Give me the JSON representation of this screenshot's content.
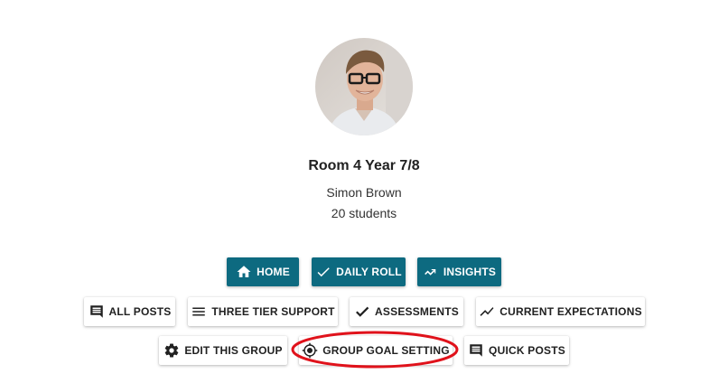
{
  "group": {
    "name": "Room 4 Year 7/8",
    "teacher": "Simon Brown",
    "student_count": "20 students"
  },
  "nav": {
    "home": "HOME",
    "daily_roll": "DAILY ROLL",
    "insights": "INSIGHTS"
  },
  "actions": {
    "all_posts": "ALL POSTS",
    "three_tier_support": "THREE TIER SUPPORT",
    "assessments": "ASSESSMENTS",
    "current_expectations": "CURRENT EXPECTATIONS",
    "edit_this_group": "EDIT THIS GROUP",
    "group_goal_setting": "GROUP GOAL SETTING",
    "quick_posts": "QUICK POSTS"
  },
  "colors": {
    "primary": "#0d6a80",
    "annotation": "#e0121b"
  },
  "icons": {
    "home": "home-icon",
    "daily_roll": "check-icon",
    "insights": "trending-icon",
    "all_posts": "comment-icon",
    "three_tier_support": "menu-icon",
    "assessments": "check-icon",
    "current_expectations": "trending-up-icon",
    "edit_this_group": "gear-icon",
    "group_goal_setting": "target-icon",
    "quick_posts": "comment-icon"
  }
}
